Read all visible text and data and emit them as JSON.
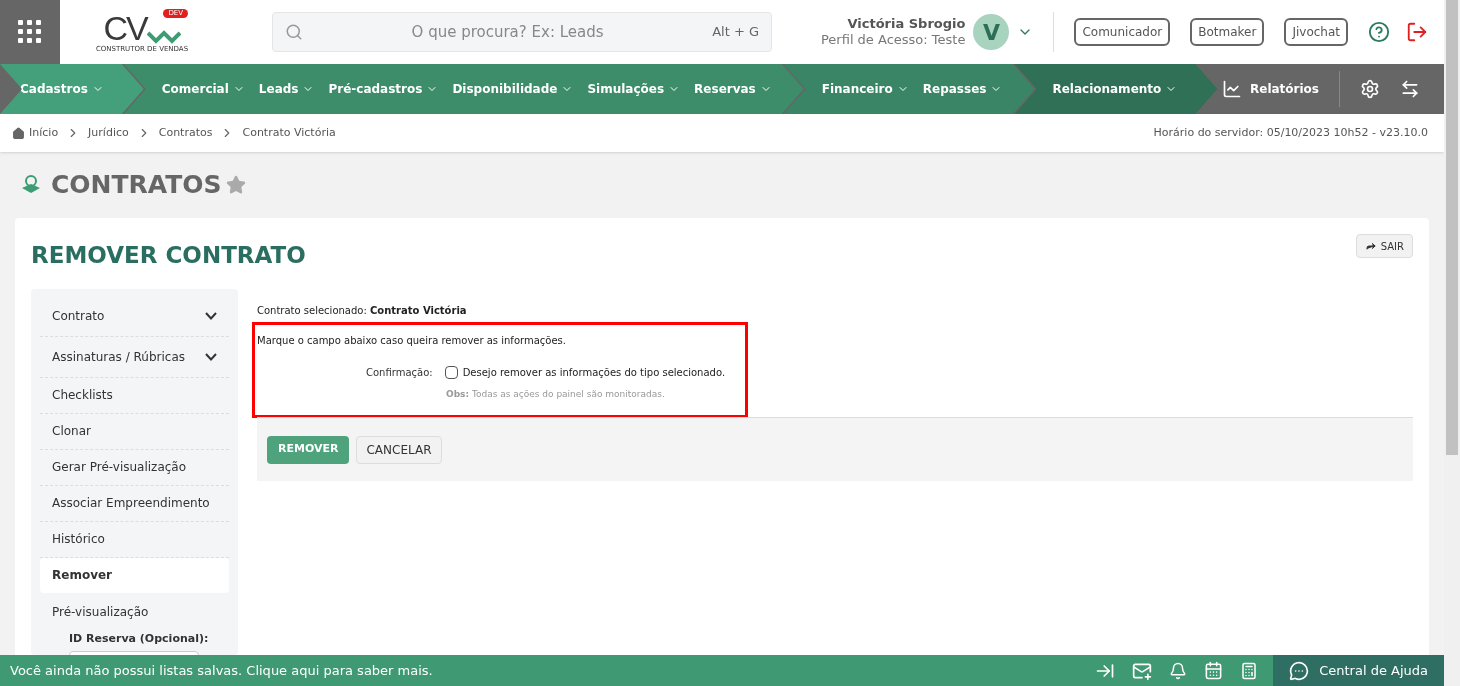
{
  "header": {
    "logo": {
      "letters": "CV",
      "badge": "DEV",
      "tagline": "CONSTRUTOR DE VENDAS"
    },
    "search": {
      "placeholder": "O que procura? Ex: Leads",
      "shortcut": "Alt + G"
    },
    "user": {
      "name": "Victória Sbrogio",
      "profile": "Perfil de Acesso: Teste",
      "initial": "V"
    },
    "buttons": [
      "Comunicador",
      "Botmaker",
      "Jivochat"
    ]
  },
  "nav": {
    "groups": [
      {
        "color": "#44a07a",
        "items": [
          "Cadastros"
        ]
      },
      {
        "color": "#3d8c6a",
        "items": [
          "Comercial",
          "Leads",
          "Pré-cadastros",
          "Disponibilidade",
          "Simulações",
          "Reservas"
        ]
      },
      {
        "color": "#3a8566",
        "items": [
          "Financeiro",
          "Repasses"
        ]
      },
      {
        "color": "#2f7056",
        "items": [
          "Relacionamento"
        ]
      }
    ],
    "reports": "Relatórios"
  },
  "breadcrumb": {
    "items": [
      "Início",
      "Jurídico",
      "Contratos",
      "Contrato Victória"
    ],
    "server_time": "Horário do servidor: 05/10/2023 10h52 - v23.10.0"
  },
  "page_title": "CONTRATOS",
  "card": {
    "title": "REMOVER CONTRATO",
    "exit_button": "SAIR",
    "sidebar": [
      {
        "label": "Contrato",
        "kind": "expandable",
        "selected": false
      },
      {
        "label": "Assinaturas / Rúbricas",
        "kind": "expandable",
        "selected": false
      },
      {
        "label": "Checklists",
        "kind": "link",
        "selected": false
      },
      {
        "label": "Clonar",
        "kind": "link",
        "selected": false
      },
      {
        "label": "Gerar Pré-visualização",
        "kind": "link",
        "selected": false
      },
      {
        "label": "Associar Empreendimento",
        "kind": "link",
        "selected": false
      },
      {
        "label": "Histórico",
        "kind": "link",
        "selected": false
      },
      {
        "label": "Remover",
        "kind": "link",
        "selected": true
      },
      {
        "label": "Pré-visualização",
        "kind": "form",
        "selected": false,
        "field_label": "ID Reserva (Opcional):"
      }
    ],
    "selected_label": "Contrato selecionado:",
    "selected_value": "Contrato Victória",
    "instruction": "Marque o campo abaixo caso queira remover as informações.",
    "confirmation": {
      "label": "Confirmação:",
      "checked": false,
      "text": "Desejo remover as informações do tipo selecionado."
    },
    "obs": {
      "label": "Obs:",
      "text": "Todas as ações do painel são monitoradas."
    },
    "actions": [
      "REMOVER",
      "CANCELAR"
    ]
  },
  "footer": {
    "message": "Você ainda não possui listas salvas. Clique aqui para saber mais.",
    "help": "Central de Ajuda"
  }
}
